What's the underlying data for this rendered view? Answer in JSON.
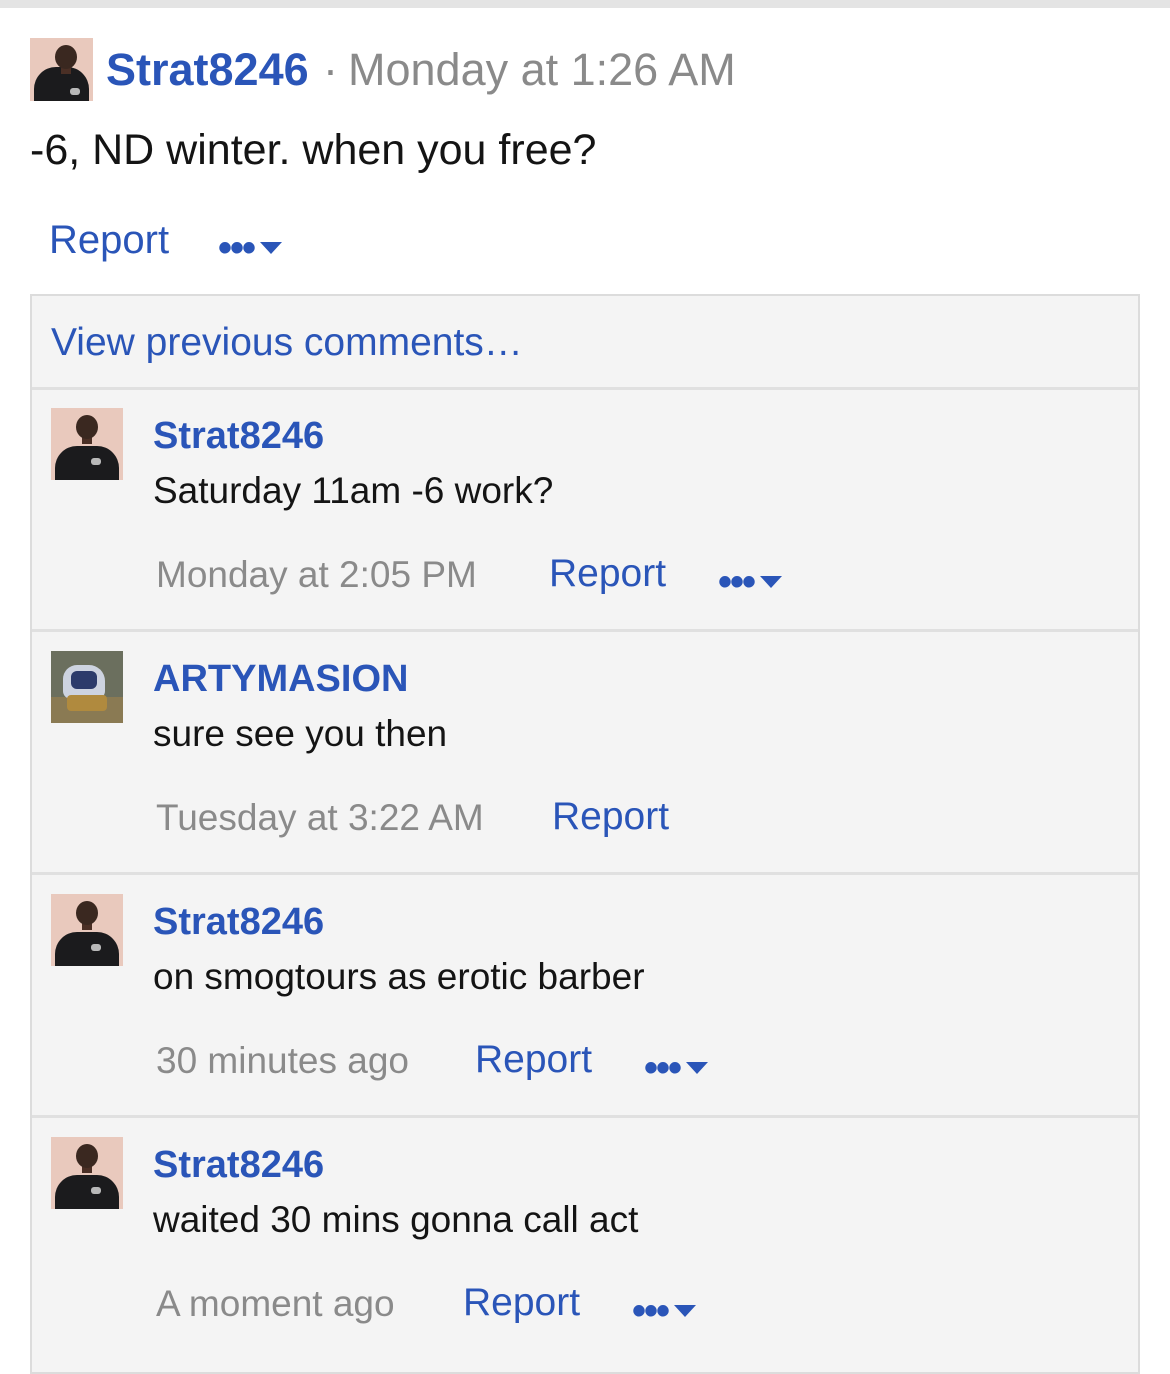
{
  "post": {
    "author": "Strat8246",
    "separator": "·",
    "timestamp": "Monday at 1:26 AM",
    "body": "-6, ND winter. when you free?",
    "report_label": "Report",
    "more_label": "•••"
  },
  "comments_panel": {
    "view_previous_label": "View previous comments…",
    "comments": [
      {
        "author": "Strat8246",
        "text": "Saturday 11am -6 work?",
        "timestamp": "Monday at 2:05 PM",
        "report_label": "Report",
        "more_label": "•••"
      },
      {
        "author": "ARTYMASION",
        "text": "sure see you then",
        "timestamp": "Tuesday at 3:22 AM",
        "report_label": "Report"
      },
      {
        "author": "Strat8246",
        "text": "on smogtours as erotic barber",
        "timestamp": "30 minutes ago",
        "report_label": "Report",
        "more_label": "•••"
      },
      {
        "author": "Strat8246",
        "text": "waited 30 mins gonna call act",
        "timestamp": "A moment ago",
        "report_label": "Report",
        "more_label": "•••"
      }
    ]
  },
  "colors": {
    "link": "#2a55b8",
    "muted": "#8a8a8a",
    "panel_bg": "#f4f4f4"
  },
  "icons": {
    "more": "ellipsis-icon",
    "dropdown": "caret-down-icon"
  }
}
